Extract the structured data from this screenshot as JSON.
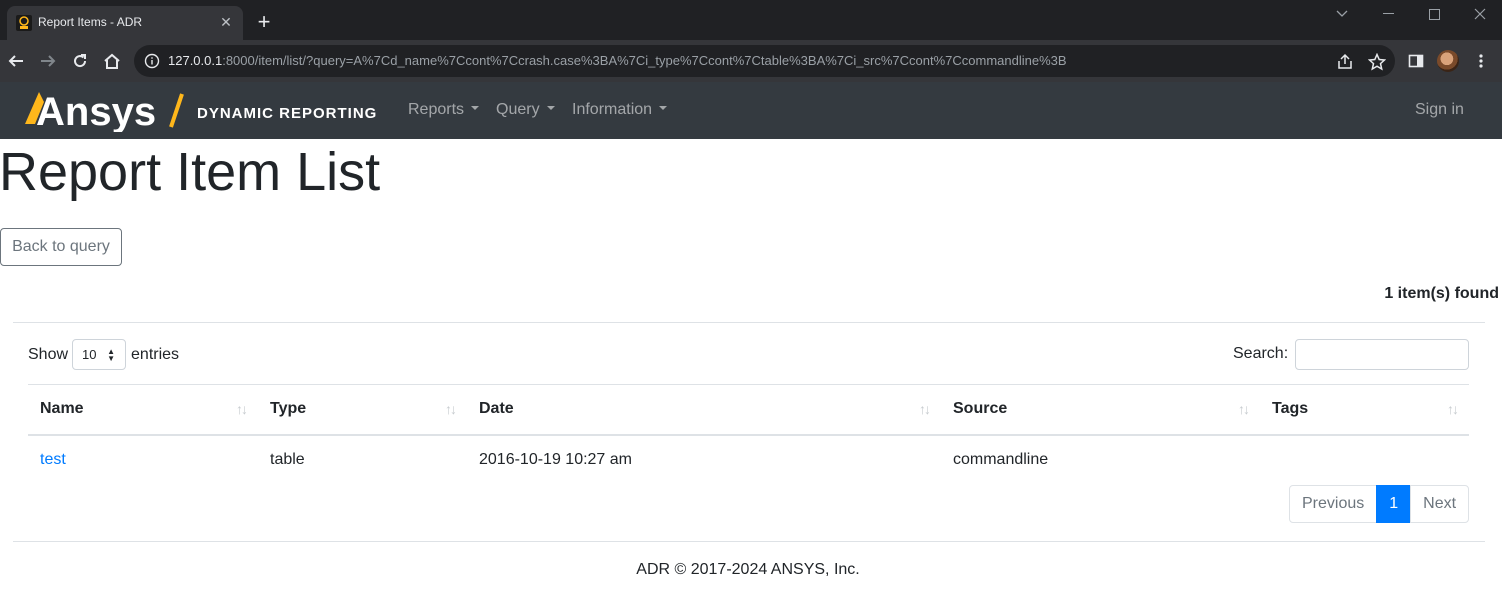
{
  "browser": {
    "tab_title": "Report Items - ADR",
    "url_host": "127.0.0.1",
    "url_rest": ":8000/item/list/?query=A%7Cd_name%7Ccont%7Ccrash.case%3BA%7Ci_type%7Ccont%7Ctable%3BA%7Ci_src%7Ccont%7Ccommandline%3B"
  },
  "navbar": {
    "brand": "Ansys",
    "brand_sub": "DYNAMIC REPORTING",
    "menus": [
      {
        "label": "Reports"
      },
      {
        "label": "Query"
      },
      {
        "label": "Information"
      }
    ],
    "sign_in": "Sign in"
  },
  "page": {
    "title": "Report Item List",
    "back_button": "Back to query",
    "found": "1 item(s) found"
  },
  "table_controls": {
    "show_label": "Show",
    "entries_value": "10",
    "entries_label": "entries",
    "search_label": "Search:",
    "search_value": ""
  },
  "table": {
    "columns": [
      "Name",
      "Type",
      "Date",
      "Source",
      "Tags"
    ],
    "rows": [
      {
        "name": "test",
        "type": "table",
        "date": "2016-10-19 10:27 am",
        "source": "commandline",
        "tags": ""
      }
    ]
  },
  "pagination": {
    "previous": "Previous",
    "current": "1",
    "next": "Next"
  },
  "footer": "ADR © 2017-2024 ANSYS, Inc.",
  "colors": {
    "navbar_bg": "#343a40",
    "brand_accent": "#ffb71b",
    "link": "#007bff",
    "active_page": "#007bff"
  }
}
